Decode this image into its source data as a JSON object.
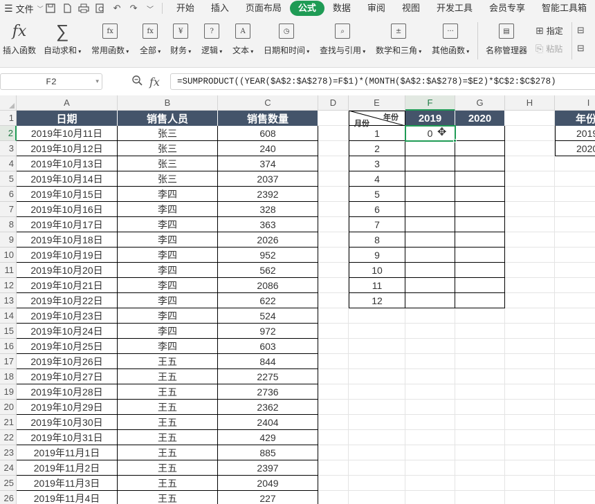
{
  "menubar": {
    "file_label": "文件",
    "tabs": [
      {
        "label": "开始",
        "active": false
      },
      {
        "label": "插入",
        "active": false
      },
      {
        "label": "页面布局",
        "active": false
      },
      {
        "label": "公式",
        "active": true
      },
      {
        "label": "数据",
        "active": false
      },
      {
        "label": "审阅",
        "active": false
      },
      {
        "label": "视图",
        "active": false
      },
      {
        "label": "开发工具",
        "active": false
      },
      {
        "label": "会员专享",
        "active": false
      },
      {
        "label": "智能工具箱",
        "active": false
      }
    ]
  },
  "ribbon": {
    "insert_function": "插入函数",
    "autosum": "自动求和",
    "common_functions": "常用函数",
    "all": "全部",
    "finance": "财务",
    "logic": "逻辑",
    "text": "文本",
    "datetime": "日期和时间",
    "lookup": "查找与引用",
    "math": "数学和三角",
    "other": "其他函数",
    "name_manager": "名称管理器",
    "specify": "指定",
    "paste": "粘贴"
  },
  "formula_bar": {
    "name_box": "F2",
    "fx": "fx",
    "formula": "=SUMPRODUCT((YEAR($A$2:$A$278)=F$1)*(MONTH($A$2:$A$278)=$E2)*$C$2:$C$278)"
  },
  "sheet": {
    "columns": [
      "A",
      "B",
      "C",
      "D",
      "E",
      "F",
      "G",
      "H",
      "I"
    ],
    "rows": [
      "1",
      "2",
      "3",
      "4",
      "5",
      "6",
      "7",
      "8",
      "9",
      "10",
      "11",
      "12",
      "13",
      "14",
      "15",
      "16",
      "17",
      "18",
      "19",
      "20",
      "21",
      "22",
      "23",
      "24",
      "25",
      "26"
    ],
    "headers": {
      "date": "日期",
      "person": "销售人员",
      "qty": "销售数量"
    },
    "data": [
      [
        "2019年10月11日",
        "张三",
        "608"
      ],
      [
        "2019年10月12日",
        "张三",
        "240"
      ],
      [
        "2019年10月13日",
        "张三",
        "374"
      ],
      [
        "2019年10月14日",
        "张三",
        "2037"
      ],
      [
        "2019年10月15日",
        "李四",
        "2392"
      ],
      [
        "2019年10月16日",
        "李四",
        "328"
      ],
      [
        "2019年10月17日",
        "李四",
        "363"
      ],
      [
        "2019年10月18日",
        "李四",
        "2026"
      ],
      [
        "2019年10月19日",
        "李四",
        "952"
      ],
      [
        "2019年10月20日",
        "李四",
        "562"
      ],
      [
        "2019年10月21日",
        "李四",
        "2086"
      ],
      [
        "2019年10月22日",
        "李四",
        "622"
      ],
      [
        "2019年10月23日",
        "李四",
        "524"
      ],
      [
        "2019年10月24日",
        "李四",
        "972"
      ],
      [
        "2019年10月25日",
        "李四",
        "603"
      ],
      [
        "2019年10月26日",
        "王五",
        "844"
      ],
      [
        "2019年10月27日",
        "王五",
        "2275"
      ],
      [
        "2019年10月28日",
        "王五",
        "2736"
      ],
      [
        "2019年10月29日",
        "王五",
        "2362"
      ],
      [
        "2019年10月30日",
        "王五",
        "2404"
      ],
      [
        "2019年10月31日",
        "王五",
        "429"
      ],
      [
        "2019年11月1日",
        "王五",
        "885"
      ],
      [
        "2019年11月2日",
        "王五",
        "2397"
      ],
      [
        "2019年11月3日",
        "王五",
        "2049"
      ],
      [
        "2019年11月4日",
        "王五",
        "227"
      ]
    ],
    "summary": {
      "diag_top": "年份",
      "diag_bottom": "月份",
      "years": [
        "2019",
        "2020"
      ],
      "months": [
        "1",
        "2",
        "3",
        "4",
        "5",
        "6",
        "7",
        "8",
        "9",
        "10",
        "11",
        "12"
      ],
      "f2_value": "0"
    },
    "side_table": {
      "header": "年份",
      "values": [
        "2019",
        "2020"
      ]
    }
  }
}
